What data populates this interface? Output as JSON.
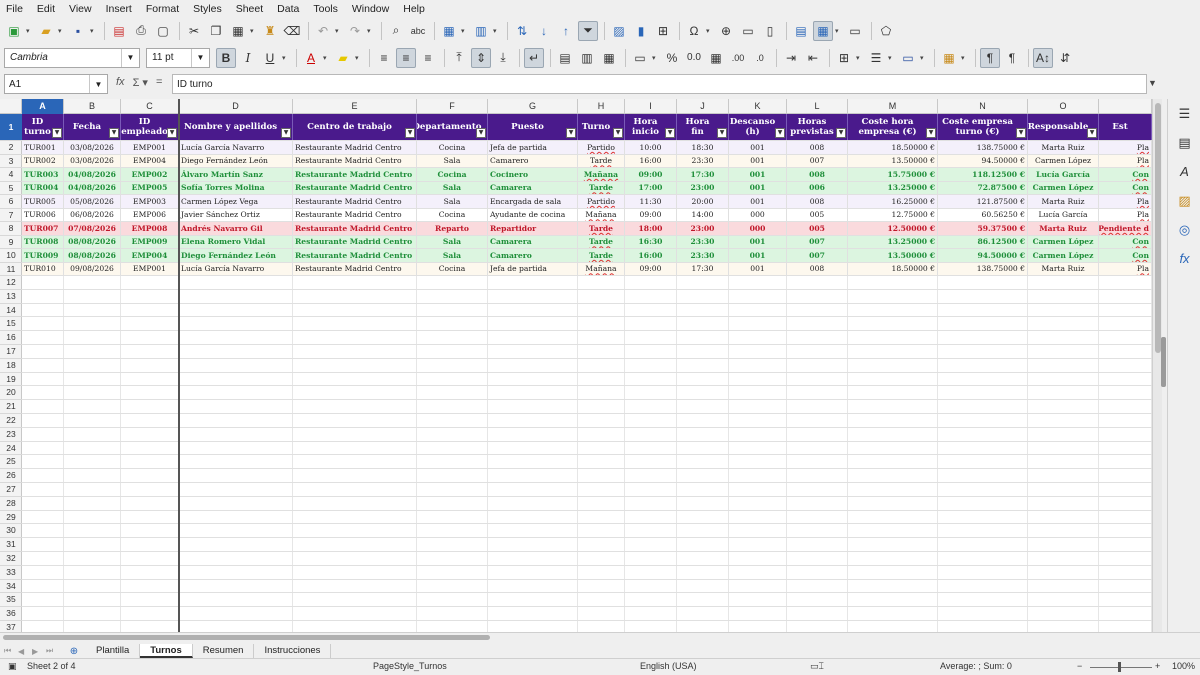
{
  "menu": [
    "File",
    "Edit",
    "View",
    "Insert",
    "Format",
    "Styles",
    "Sheet",
    "Data",
    "Tools",
    "Window",
    "Help"
  ],
  "format_bar": {
    "font_name": "Cambria",
    "font_size": "11 pt"
  },
  "formula_bar": {
    "cell_ref": "A1",
    "content": "ID turno"
  },
  "columns": [
    "A",
    "B",
    "C",
    "D",
    "E",
    "F",
    "G",
    "H",
    "I",
    "J",
    "K",
    "L",
    "M",
    "N",
    "O",
    ""
  ],
  "headers": [
    "ID turno",
    "Fecha",
    "ID empleado",
    "Nombre y apellidos",
    "Centro de trabajo",
    "Departamento",
    "Puesto",
    "Turno",
    "Hora inicio",
    "Hora fin",
    "Descanso (h)",
    "Horas previstas",
    "Coste hora empresa (€)",
    "Coste empresa turno (€)",
    "Responsable",
    "Est"
  ],
  "rows": [
    {
      "style": "lav",
      "cells": [
        "TUR001",
        "03/08/2026",
        "EMP001",
        "Lucía García Navarro",
        "Restaurante Madrid Centro",
        "Cocina",
        "Jefa de partida",
        "Partido",
        "10:00",
        "18:30",
        "001",
        "008",
        "18.50000 €",
        "138.75000 €",
        "Marta Ruiz",
        "Pla"
      ]
    },
    {
      "style": "cream",
      "cells": [
        "TUR002",
        "03/08/2026",
        "EMP004",
        "Diego Fernández León",
        "Restaurante Madrid Centro",
        "Sala",
        "Camarero",
        "Tarde",
        "16:00",
        "23:30",
        "001",
        "007",
        "13.50000 €",
        "94.50000 €",
        "Carmen López",
        "Pla"
      ]
    },
    {
      "style": "green",
      "cells": [
        "TUR003",
        "04/08/2026",
        "EMP002",
        "Álvaro Martín Sanz",
        "Restaurante Madrid Centro",
        "Cocina",
        "Cocinero",
        "Mañana",
        "09:00",
        "17:30",
        "001",
        "008",
        "15.75000 €",
        "118.12500 €",
        "Lucía García",
        "Con"
      ]
    },
    {
      "style": "green",
      "cells": [
        "TUR004",
        "04/08/2026",
        "EMP005",
        "Sofía Torres Molina",
        "Restaurante Madrid Centro",
        "Sala",
        "Camarera",
        "Tarde",
        "17:00",
        "23:00",
        "001",
        "006",
        "13.25000 €",
        "72.87500 €",
        "Carmen López",
        "Con"
      ]
    },
    {
      "style": "lav",
      "cells": [
        "TUR005",
        "05/08/2026",
        "EMP003",
        "Carmen López Vega",
        "Restaurante Madrid Centro",
        "Sala",
        "Encargada de sala",
        "Partido",
        "11:30",
        "20:00",
        "001",
        "008",
        "16.25000 €",
        "121.87500 €",
        "Marta Ruiz",
        "Pla"
      ]
    },
    {
      "style": "plain",
      "cells": [
        "TUR006",
        "06/08/2026",
        "EMP006",
        "Javier Sánchez Ortiz",
        "Restaurante Madrid Centro",
        "Cocina",
        "Ayudante de cocina",
        "Mañana",
        "09:00",
        "14:00",
        "000",
        "005",
        "12.75000 €",
        "60.56250 €",
        "Lucía García",
        "Pla"
      ]
    },
    {
      "style": "red",
      "cells": [
        "TUR007",
        "07/08/2026",
        "EMP008",
        "Andrés Navarro Gil",
        "Restaurante Madrid Centro",
        "Reparto",
        "Repartidor",
        "Tarde",
        "18:00",
        "23:00",
        "000",
        "005",
        "12.50000 €",
        "59.37500 €",
        "Marta Ruiz",
        "Pendiente d"
      ]
    },
    {
      "style": "green",
      "cells": [
        "TUR008",
        "08/08/2026",
        "EMP009",
        "Elena Romero Vidal",
        "Restaurante Madrid Centro",
        "Sala",
        "Camarera",
        "Tarde",
        "16:30",
        "23:30",
        "001",
        "007",
        "13.25000 €",
        "86.12500 €",
        "Carmen López",
        "Con"
      ]
    },
    {
      "style": "green",
      "cells": [
        "TUR009",
        "08/08/2026",
        "EMP004",
        "Diego Fernández León",
        "Restaurante Madrid Centro",
        "Sala",
        "Camarero",
        "Tarde",
        "16:00",
        "23:30",
        "001",
        "007",
        "13.50000 €",
        "94.50000 €",
        "Carmen López",
        "Con"
      ]
    },
    {
      "style": "cream",
      "cells": [
        "TUR010",
        "09/08/2026",
        "EMP001",
        "Lucía García Navarro",
        "Restaurante Madrid Centro",
        "Cocina",
        "Jefa de partida",
        "Mañana",
        "09:00",
        "17:30",
        "001",
        "008",
        "18.50000 €",
        "138.75000 €",
        "Marta Ruiz",
        "Pla"
      ]
    }
  ],
  "row_numbers": [
    "1",
    "2",
    "3",
    "4",
    "5",
    "6",
    "7",
    "8",
    "9",
    "10",
    "11",
    "12",
    "13",
    "14",
    "15",
    "16",
    "17",
    "18",
    "19",
    "20",
    "21",
    "22",
    "23",
    "24",
    "25",
    "26",
    "27",
    "28",
    "29",
    "30",
    "31",
    "32",
    "33",
    "34",
    "35",
    "36",
    "37"
  ],
  "sheet_tabs": [
    "Plantilla",
    "Turnos",
    "Resumen",
    "Instrucciones"
  ],
  "active_tab": "Turnos",
  "status": {
    "sheet": "Sheet 2 of 4",
    "page_style": "PageStyle_Turnos",
    "language": "English (USA)",
    "summary": "Average: ; Sum: 0",
    "zoom": "100%"
  }
}
